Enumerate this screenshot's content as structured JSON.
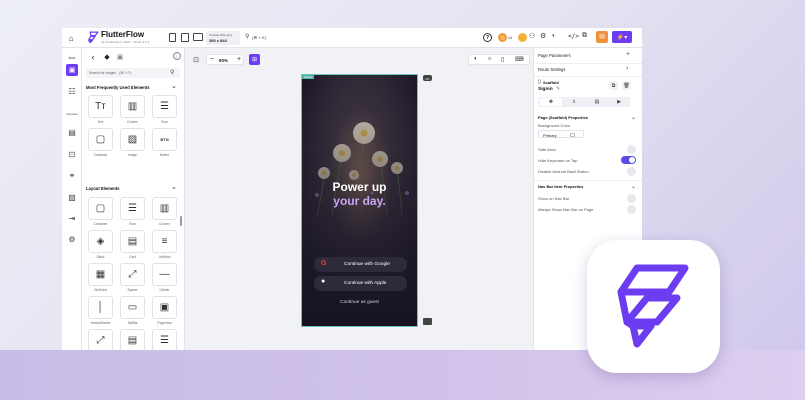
{
  "app": {
    "name": "FlutterFlow",
    "version": "v3.0 February 2, 2023 · Flutter 3.3.4",
    "canvas_size_label": "Canvas Size (px)",
    "canvas_size": "390 x 844",
    "search_shortcut": "(⌘ + K)",
    "notif_count": "x1",
    "brand_color": "#6d3cf4"
  },
  "rail": {
    "build_label": "Build",
    "connect_label": "Connect"
  },
  "widgets": {
    "search_placeholder": "Search for widget... (⌘ + F)",
    "section1": "Most Frequently Used Elements",
    "section2": "Layout Elements",
    "frequent": [
      {
        "label": "Text",
        "icon": "Tт"
      },
      {
        "label": "Column",
        "icon": "▥"
      },
      {
        "label": "Row",
        "icon": "☰"
      },
      {
        "label": "Container",
        "icon": "▢"
      },
      {
        "label": "Image",
        "icon": "▨"
      },
      {
        "label": "Button",
        "icon": "BTN"
      }
    ],
    "layout": [
      {
        "label": "Container",
        "icon": "▢"
      },
      {
        "label": "Row",
        "icon": "☰"
      },
      {
        "label": "Column",
        "icon": "▥"
      },
      {
        "label": "Stack",
        "icon": "◈"
      },
      {
        "label": "Card",
        "icon": "▤"
      },
      {
        "label": "ListView",
        "icon": "≡"
      },
      {
        "label": "GridView",
        "icon": "▦"
      },
      {
        "label": "Spacer",
        "icon": "⤢"
      },
      {
        "label": "Divider",
        "icon": "—"
      },
      {
        "label": "VerticalDivider",
        "icon": "│"
      },
      {
        "label": "TabBar",
        "icon": "▭"
      },
      {
        "label": "PageView",
        "icon": "▣"
      },
      {
        "label": "Expandable",
        "icon": "⤢"
      },
      {
        "label": "Wrap",
        "icon": "▤"
      },
      {
        "label": "Form",
        "icon": "☰"
      },
      {
        "label": "",
        "icon": "▦"
      },
      {
        "label": "",
        "icon": "▬"
      },
      {
        "label": "",
        "icon": "▨"
      }
    ]
  },
  "canvas": {
    "zoom": "90%",
    "phone_tag": "Signin",
    "headline_1": "Power up",
    "headline_2": "your day.",
    "google_button": "Continue with Google",
    "apple_button": "Continue with Apple",
    "guest_link": "Continue as guest"
  },
  "properties": {
    "page_parameters": "Page Parameters",
    "route_settings": "Route Settings",
    "widget_type": "Scaffold",
    "page_name": "Signin",
    "scaffold_section": "Page (Scaffold) Properties",
    "background_color_label": "Background Color",
    "background_color_value": "Primary",
    "safe_area": "Safe Area",
    "hide_keyboard": "Hide Keyboard on Tap",
    "disable_back": "Disable Android Back Button",
    "nav_section": "Nav Bar Item Properties",
    "show_nav": "Show on Nav Bar",
    "always_show_nav": "Always Show Nav Bar on Page"
  }
}
